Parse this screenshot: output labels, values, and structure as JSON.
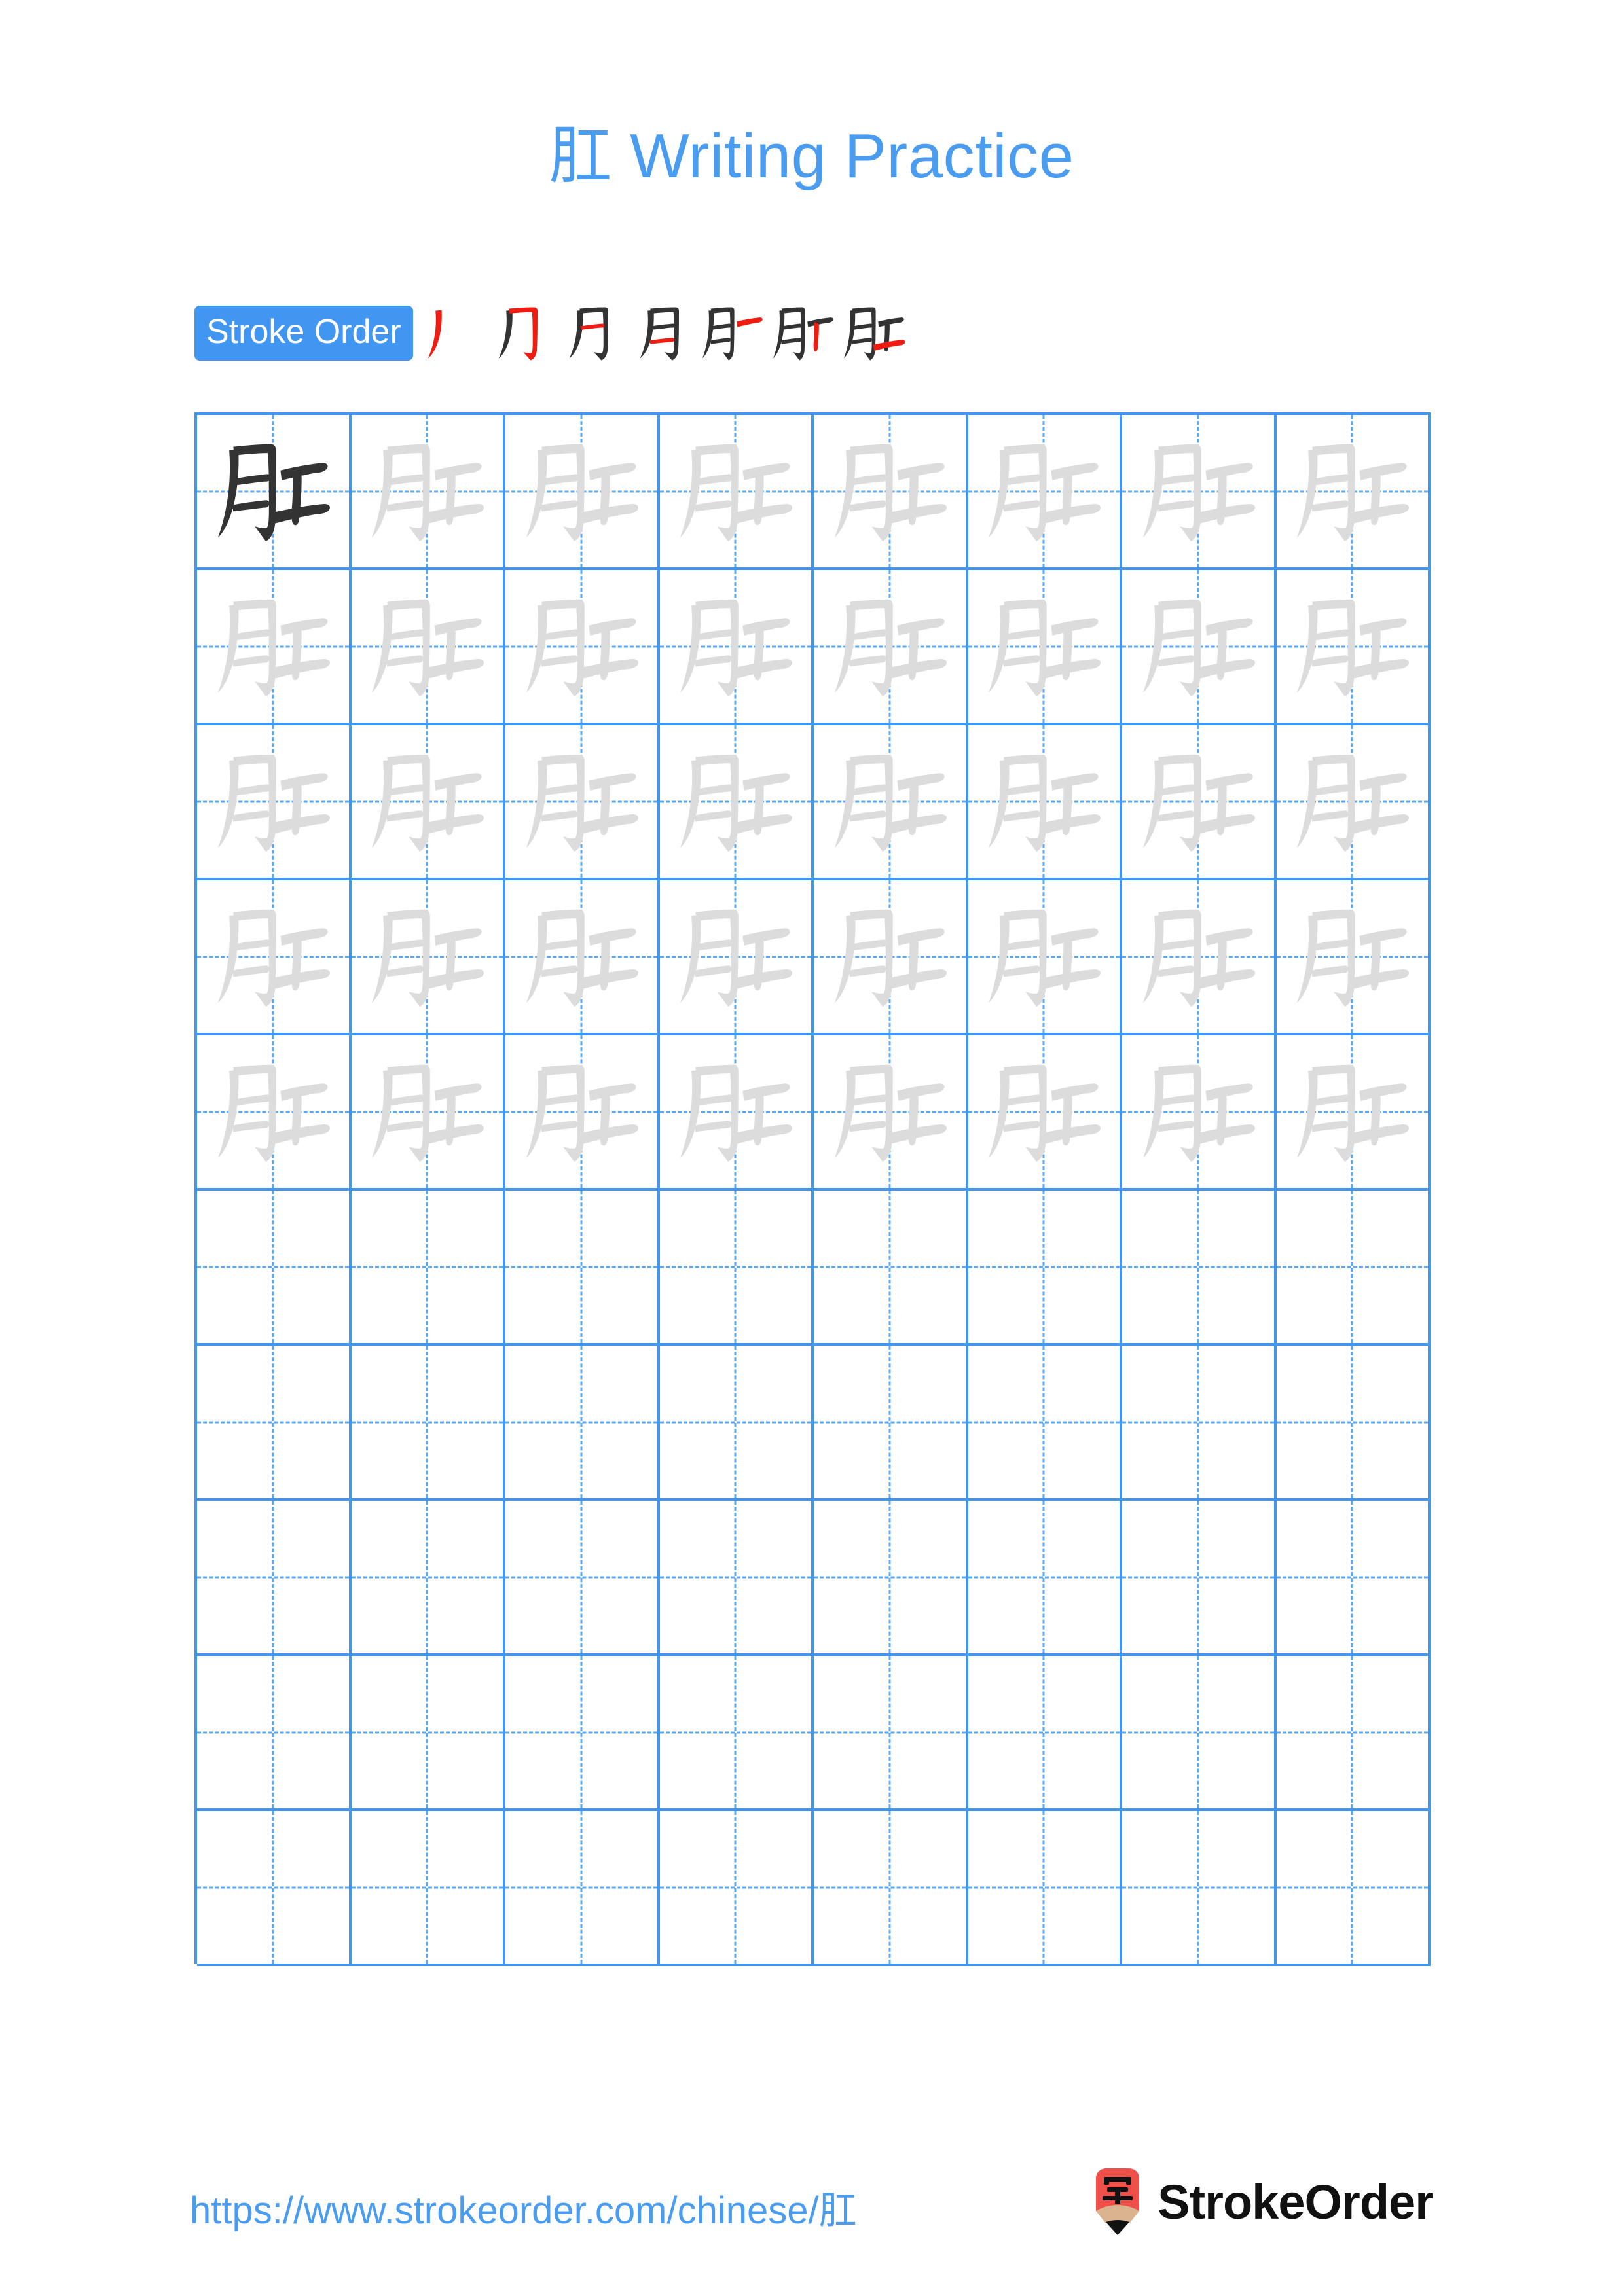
{
  "character": "肛",
  "page": {
    "title": "肛 Writing Practice",
    "background_color": "#ffffff"
  },
  "colors": {
    "accent_blue": "#4A9CF0",
    "badge_blue": "#4096F0",
    "grid_line": "#4096F0",
    "guide_dash": "#5AA7F2",
    "glyph_dark": "#333333",
    "glyph_trace": "#DCDCDC",
    "stroke_new": "#EE1C11",
    "stroke_done": "#333333",
    "logo_red": "#F0504A",
    "logo_wood": "#D9B48F",
    "logo_tip": "#111111"
  },
  "stroke_order": {
    "badge_label": "Stroke Order",
    "total_strokes": 7,
    "steps": [
      {
        "index": 1,
        "name": "stroke-step-1",
        "description": "left downward sweep of 月 radical"
      },
      {
        "index": 2,
        "name": "stroke-step-2",
        "description": "top horizontal with hooked right vertical of 月"
      },
      {
        "index": 3,
        "name": "stroke-step-3",
        "description": "upper inner horizontal of 月"
      },
      {
        "index": 4,
        "name": "stroke-step-4",
        "description": "lower inner horizontal of 月"
      },
      {
        "index": 5,
        "name": "stroke-step-5",
        "description": "top horizontal of 工"
      },
      {
        "index": 6,
        "name": "stroke-step-6",
        "description": "center vertical of 工"
      },
      {
        "index": 7,
        "name": "stroke-step-7",
        "description": "bottom horizontal of 工"
      }
    ]
  },
  "practice_grid": {
    "columns": 8,
    "rows": 10,
    "filled_rows": 5,
    "model_cell": {
      "row": 1,
      "column": 1,
      "style": "dark"
    },
    "cells": [
      [
        "dark",
        "trace",
        "trace",
        "trace",
        "trace",
        "trace",
        "trace",
        "trace"
      ],
      [
        "trace",
        "trace",
        "trace",
        "trace",
        "trace",
        "trace",
        "trace",
        "trace"
      ],
      [
        "trace",
        "trace",
        "trace",
        "trace",
        "trace",
        "trace",
        "trace",
        "trace"
      ],
      [
        "trace",
        "trace",
        "trace",
        "trace",
        "trace",
        "trace",
        "trace",
        "trace"
      ],
      [
        "trace",
        "trace",
        "trace",
        "trace",
        "trace",
        "trace",
        "trace",
        "trace"
      ],
      [
        "empty",
        "empty",
        "empty",
        "empty",
        "empty",
        "empty",
        "empty",
        "empty"
      ],
      [
        "empty",
        "empty",
        "empty",
        "empty",
        "empty",
        "empty",
        "empty",
        "empty"
      ],
      [
        "empty",
        "empty",
        "empty",
        "empty",
        "empty",
        "empty",
        "empty",
        "empty"
      ],
      [
        "empty",
        "empty",
        "empty",
        "empty",
        "empty",
        "empty",
        "empty",
        "empty"
      ],
      [
        "empty",
        "empty",
        "empty",
        "empty",
        "empty",
        "empty",
        "empty",
        "empty"
      ]
    ]
  },
  "footer": {
    "url": "https://www.strokeorder.com/chinese/肛",
    "brand_name": "StrokeOrder",
    "logo_character": "字"
  }
}
